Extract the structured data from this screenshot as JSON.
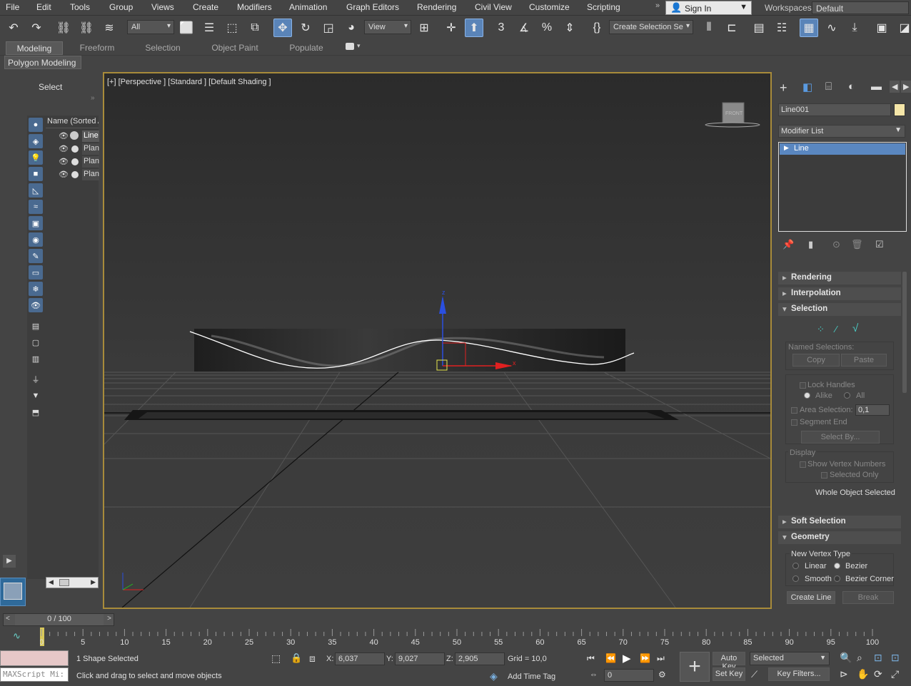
{
  "menubar": {
    "items": [
      "File",
      "Edit",
      "Tools",
      "Group",
      "Views",
      "Create",
      "Modifiers",
      "Animation",
      "Graph Editors",
      "Rendering",
      "Civil View",
      "Customize",
      "Scripting"
    ],
    "sign_in": "Sign In",
    "workspaces_label": "Workspaces:",
    "workspace_value": "Default"
  },
  "toolbar": {
    "filter_value": "All",
    "coord_value": "View",
    "selection_set_placeholder": "Create Selection Se"
  },
  "ribbon": {
    "tabs": [
      "Modeling",
      "Freeform",
      "Selection",
      "Object Paint",
      "Populate"
    ],
    "active_tab": "Modeling",
    "panel_label": "Polygon Modeling"
  },
  "scene_explorer": {
    "select_label": "Select",
    "column_header": "Name (Sorted A",
    "items": [
      "Line",
      "Plan",
      "Plan",
      "Plan"
    ]
  },
  "viewport": {
    "label": "[+] [Perspective ] [Standard ] [Default Shading ]",
    "viewcube_label": "FRONT",
    "axis_x": "x",
    "axis_z": "z"
  },
  "command_panel": {
    "object_name": "Line001",
    "object_color": "#f5e6a8",
    "modifier_list": "Modifier List",
    "stack_item": "Line",
    "rollouts": {
      "rendering": "Rendering",
      "interpolation": "Interpolation",
      "selection": "Selection",
      "soft_selection": "Soft Selection",
      "geometry": "Geometry"
    },
    "named_selections": "Named Selections:",
    "copy": "Copy",
    "paste": "Paste",
    "lock_handles": "Lock Handles",
    "alike": "Alike",
    "all": "All",
    "area_selection": "Area Selection:",
    "area_value": "0,1",
    "segment_end": "Segment End",
    "select_by": "Select By...",
    "display": "Display",
    "show_vertex_numbers": "Show Vertex Numbers",
    "selected_only": "Selected Only",
    "whole_object": "Whole Object Selected",
    "new_vertex_type": "New Vertex Type",
    "linear": "Linear",
    "bezier": "Bezier",
    "smooth": "Smooth",
    "bezier_corner": "Bezier Corner",
    "create_line": "Create Line",
    "break": "Break"
  },
  "timeline": {
    "frame_display": "0 / 100",
    "ticks": [
      "0",
      "5",
      "10",
      "15",
      "20",
      "25",
      "30",
      "35",
      "40",
      "45",
      "50",
      "55",
      "60",
      "65",
      "70",
      "75",
      "80",
      "85",
      "90",
      "95",
      "100"
    ]
  },
  "status": {
    "selection_info": "1 Shape Selected",
    "prompt": "Click and drag to select and move objects",
    "maxscript": "MAXScript Mi:",
    "x_label": "X:",
    "x_value": "6,037",
    "y_label": "Y:",
    "y_value": "9,027",
    "z_label": "Z:",
    "z_value": "2,905",
    "grid": "Grid = 10,0",
    "add_time_tag": "Add Time Tag",
    "auto_key": "Auto Key",
    "set_key": "Set Key",
    "key_mode": "Selected",
    "frame_value": "0",
    "key_filters": "Key Filters..."
  }
}
